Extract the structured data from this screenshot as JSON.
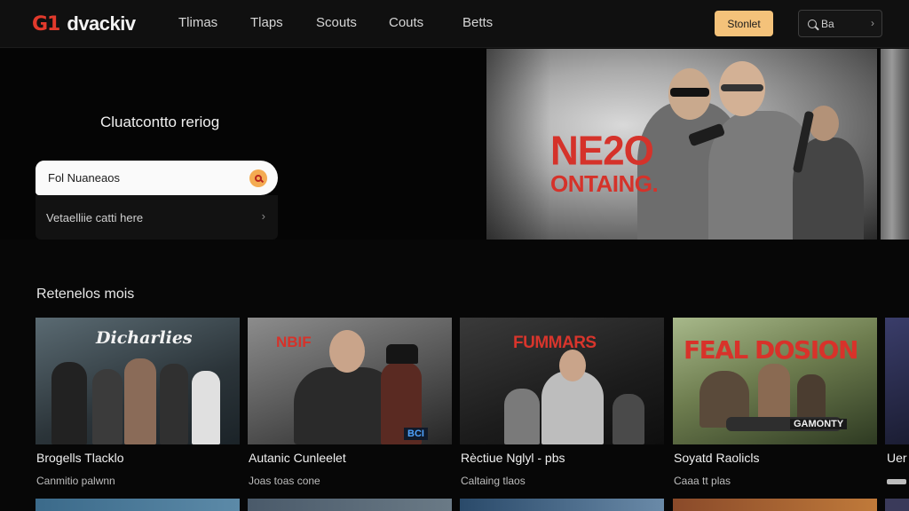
{
  "header": {
    "logo_mark": "G1",
    "logo_text": "dvackiv",
    "nav": [
      {
        "label": "Tlimas"
      },
      {
        "label": "Tlaps"
      },
      {
        "label": "Scouts"
      },
      {
        "label": "Couts"
      },
      {
        "label": "Betts"
      }
    ],
    "cta_label": "Stonlet",
    "search_text": "Ba",
    "search_chevron": "›"
  },
  "hero": {
    "heading": "Cluatcontto reriog",
    "search_value": "Fol Nuaneaos",
    "suggestion": "Vetaelliie catti here",
    "suggestion_chevron": "›",
    "title_art_line1": "NE2O",
    "title_art_line2": "ONTAING."
  },
  "section": {
    "title": "Retenelos mois",
    "cards": [
      {
        "title": "Brogells Tlacklo",
        "subtitle": "Canmitio palwnn",
        "art_text": "Dicharlies",
        "colors": [
          "#3c4a52",
          "#1b2328"
        ]
      },
      {
        "title": "Autanic Cunleelet",
        "subtitle": "Joas toas cone",
        "art_text": "NBIF",
        "badge": "BCI",
        "colors": [
          "#6e6e6e",
          "#2a2a2a"
        ]
      },
      {
        "title": "Rèctiue Nglyl - pbs",
        "subtitle": "Caltaing tlaos",
        "art_text": "FUMMARS",
        "colors": [
          "#4d4d4d",
          "#141414"
        ]
      },
      {
        "title": "Soyatd Raolicls",
        "subtitle": "Caaa tt plas",
        "art_text": "FEAL DOSION",
        "badge": "GAMONTY",
        "colors": [
          "#7a8a5a",
          "#2e3a22"
        ]
      },
      {
        "title": "Uer",
        "subtitle": "",
        "art_text": "",
        "colors": [
          "#3a3d6a",
          "#1b1d33"
        ]
      }
    ]
  },
  "colors": {
    "accent": "#f4c27a",
    "brand_red": "#e23a2c",
    "background": "#070707"
  }
}
